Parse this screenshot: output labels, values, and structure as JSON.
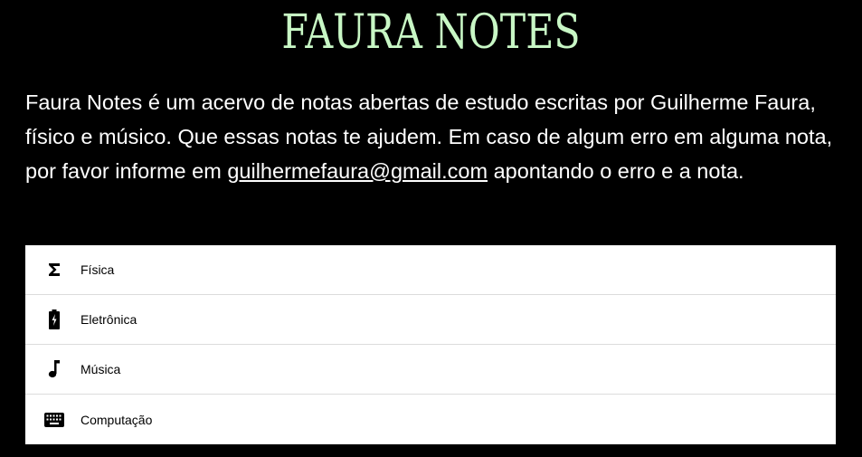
{
  "header": {
    "title": "FAURA NOTES"
  },
  "intro": {
    "text_before": "Faura Notes é um acervo de notas abertas de estudo escritas por Guilherme Faura, físico e músico. Que essas notas te ajudem. Em caso de algum erro em alguma nota, por favor informe em ",
    "email": "guilhermefaura@gmail.com",
    "text_after": " apontando o erro e a nota."
  },
  "menu": {
    "items": [
      {
        "label": "Física",
        "icon": "sigma-icon"
      },
      {
        "label": "Eletrônica",
        "icon": "battery-charging-icon"
      },
      {
        "label": "Música",
        "icon": "music-note-icon"
      },
      {
        "label": "Computação",
        "icon": "keyboard-icon"
      }
    ]
  },
  "colors": {
    "background": "#000000",
    "title": "#c8f7c5",
    "text": "#ffffff",
    "menu_background": "#ffffff",
    "divider": "#dcdcdc"
  }
}
